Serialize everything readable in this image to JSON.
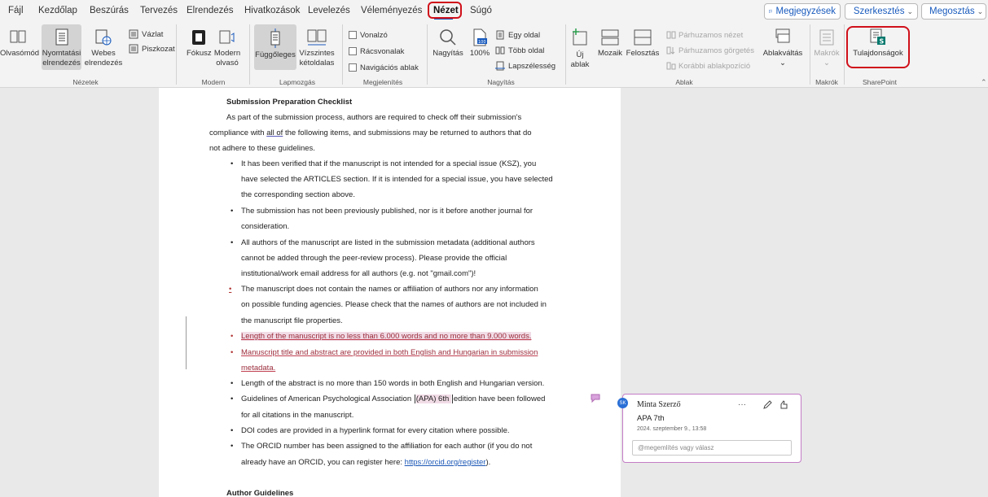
{
  "tabs": [
    "Fájl",
    "Kezdőlap",
    "Beszúrás",
    "Tervezés",
    "Elrendezés",
    "Hivatkozások",
    "Levelezés",
    "Véleményezés",
    "Nézet",
    "Súgó"
  ],
  "top_buttons": {
    "comments": "Megjegyzések",
    "editing": "Szerkesztés",
    "share": "Megosztás"
  },
  "ribbon": {
    "views": {
      "reading_mode": "Olvasómód",
      "print_layout_1": "Nyomtatási",
      "print_layout_2": "elrendezés",
      "web_layout_1": "Webes",
      "web_layout_2": "elrendezés",
      "outline": "Vázlat",
      "draft": "Piszkozat",
      "group": "Nézetek"
    },
    "modern": {
      "focus": "Fókusz",
      "modern_reader_1": "Modern",
      "modern_reader_2": "olvasó",
      "group": "Modern"
    },
    "page_movement": {
      "vertical": "Függőleges",
      "side_to_side_1": "Vízszintes",
      "side_to_side_2": "kétoldalas",
      "group": "Lapmozgás"
    },
    "show": {
      "ruler": "Vonalzó",
      "gridlines": "Rácsvonalak",
      "nav_pane": "Navigációs ablak",
      "group": "Megjelenítés"
    },
    "zoom": {
      "zoom": "Nagyítás",
      "hundred": "100%",
      "one_page": "Egy oldal",
      "multiple_pages": "Több oldal",
      "page_width": "Lapszélesség",
      "group": "Nagyítás"
    },
    "window": {
      "new_window_1": "Új",
      "new_window_2": "ablak",
      "arrange_all": "Mozaik",
      "split": "Felosztás",
      "side_by_side": "Párhuzamos nézet",
      "sync_scroll": "Párhuzamos görgetés",
      "reset_position": "Korábbi ablakpozíció",
      "switch_windows": "Ablakváltás",
      "group": "Ablak"
    },
    "macros": {
      "macros": "Makrók",
      "group": "Makrók"
    },
    "sharepoint": {
      "properties": "Tulajdonságok",
      "group": "SharePoint"
    }
  },
  "document": {
    "heading": "Submission Preparation Checklist",
    "intro_1": "As part of the submission process, authors are required to check off their submission's",
    "intro_2a": "compliance with ",
    "intro_2b": "all of",
    "intro_2c": " the following items, and submissions may be returned to authors that do",
    "intro_3": "not adhere to these guidelines.",
    "b1_1": "It has been verified that if the manuscript is not intended for a special issue (KSZ), you",
    "b1_2": "have selected the ARTICLES section. If it is intended for a special issue, you have selected",
    "b1_3": "the corresponding section above.",
    "b2_1": "The submission has not been previously published, nor is it before another journal for",
    "b2_2": "consideration.",
    "b3_1": "All authors of the manuscript are listed in the submission metadata (additional authors",
    "b3_2": "cannot be added through the peer-review process). Please provide the official",
    "b3_3": "institutional/work email address for all authors (e.g. not \"gmail.com\")!",
    "b4_1": "The manuscript does not contain the names or affiliation of authors nor any information",
    "b4_2": "on possible funding agencies. Please check that the names of authors are not included in",
    "b4_3": "the manuscript file properties.",
    "b5_1": "Length of the manuscript is no less than 6.000 words and no more than 9.000 words.",
    "b6_1": "Manuscript title and abstract are provided in both English and Hungarian in submission",
    "b6_2": "metadata.",
    "b7_1": "Length of the abstract is no more than 150 words in both English and Hungarian version.",
    "b8_1a": "Guidelines of American Psychological Association ",
    "b8_1b": "(APA) 6th ",
    "b8_1c": "edition have been followed",
    "b8_2": "for all citations in the manuscript.",
    "b9_1": "DOI codes are provided in a hyperlink format for every citation where possible.",
    "b10_1": "The ORCID number has been assigned to the affiliation for each author (if you do not",
    "b10_2a": "already have an ORCID, you can register here: ",
    "b10_2b": "https://orcid.org/register",
    "b10_2c": ").",
    "heading2": "Author Guidelines",
    "bullet_char": "•"
  },
  "comment": {
    "avatar": "SK",
    "author": "Minta Szerző",
    "text": "APA 7th",
    "date": "2024. szeptember 9., 13:58",
    "reply_placeholder": "@megemlítés vagy válasz",
    "more": "···"
  }
}
